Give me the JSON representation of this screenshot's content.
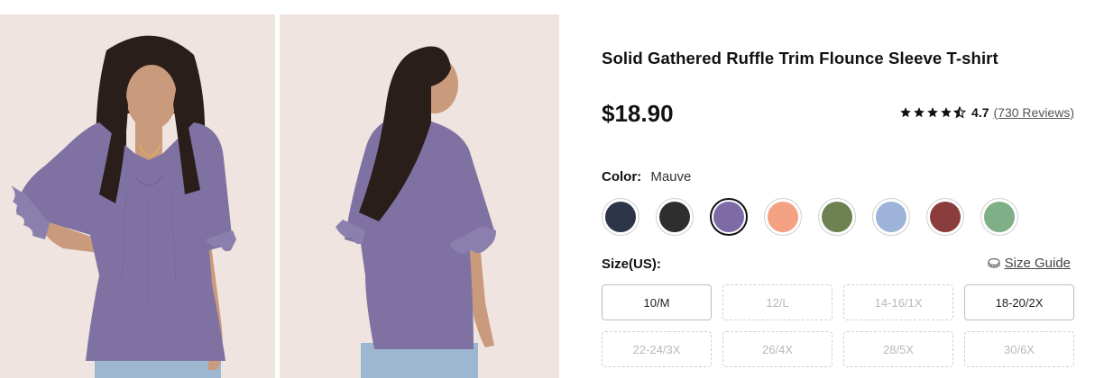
{
  "product": {
    "title": "Solid Gathered Ruffle Trim Flounce Sleeve T-shirt",
    "price": "$18.90",
    "rating": "4.7",
    "rating_stars": 4.5,
    "reviews": "(730 Reviews)"
  },
  "color": {
    "label": "Color:",
    "selected": "Mauve",
    "swatches": [
      {
        "color": "#2b3547",
        "selected": false
      },
      {
        "color": "#2e2e2e",
        "selected": false
      },
      {
        "color": "#7e6aa4",
        "selected": true
      },
      {
        "color": "#f5a184",
        "selected": false
      },
      {
        "color": "#6e8150",
        "selected": false
      },
      {
        "color": "#9db4d8",
        "selected": false
      },
      {
        "color": "#8b3d3d",
        "selected": false
      },
      {
        "color": "#7faf86",
        "selected": false
      }
    ]
  },
  "size": {
    "label": "Size(US):",
    "guide": "Size Guide",
    "options": [
      {
        "label": "10/M",
        "available": true
      },
      {
        "label": "12/L",
        "available": false
      },
      {
        "label": "14-16/1X",
        "available": false
      },
      {
        "label": "18-20/2X",
        "available": true
      },
      {
        "label": "22-24/3X",
        "available": false
      },
      {
        "label": "26/4X",
        "available": false
      },
      {
        "label": "28/5X",
        "available": false
      },
      {
        "label": "30/6X",
        "available": false
      }
    ]
  },
  "colors": {
    "garment": "#7f72a3",
    "hair": "#2a1e1a",
    "skin": "#c99a7c",
    "jeans": "#9db7d1",
    "background": "#efe4df"
  }
}
